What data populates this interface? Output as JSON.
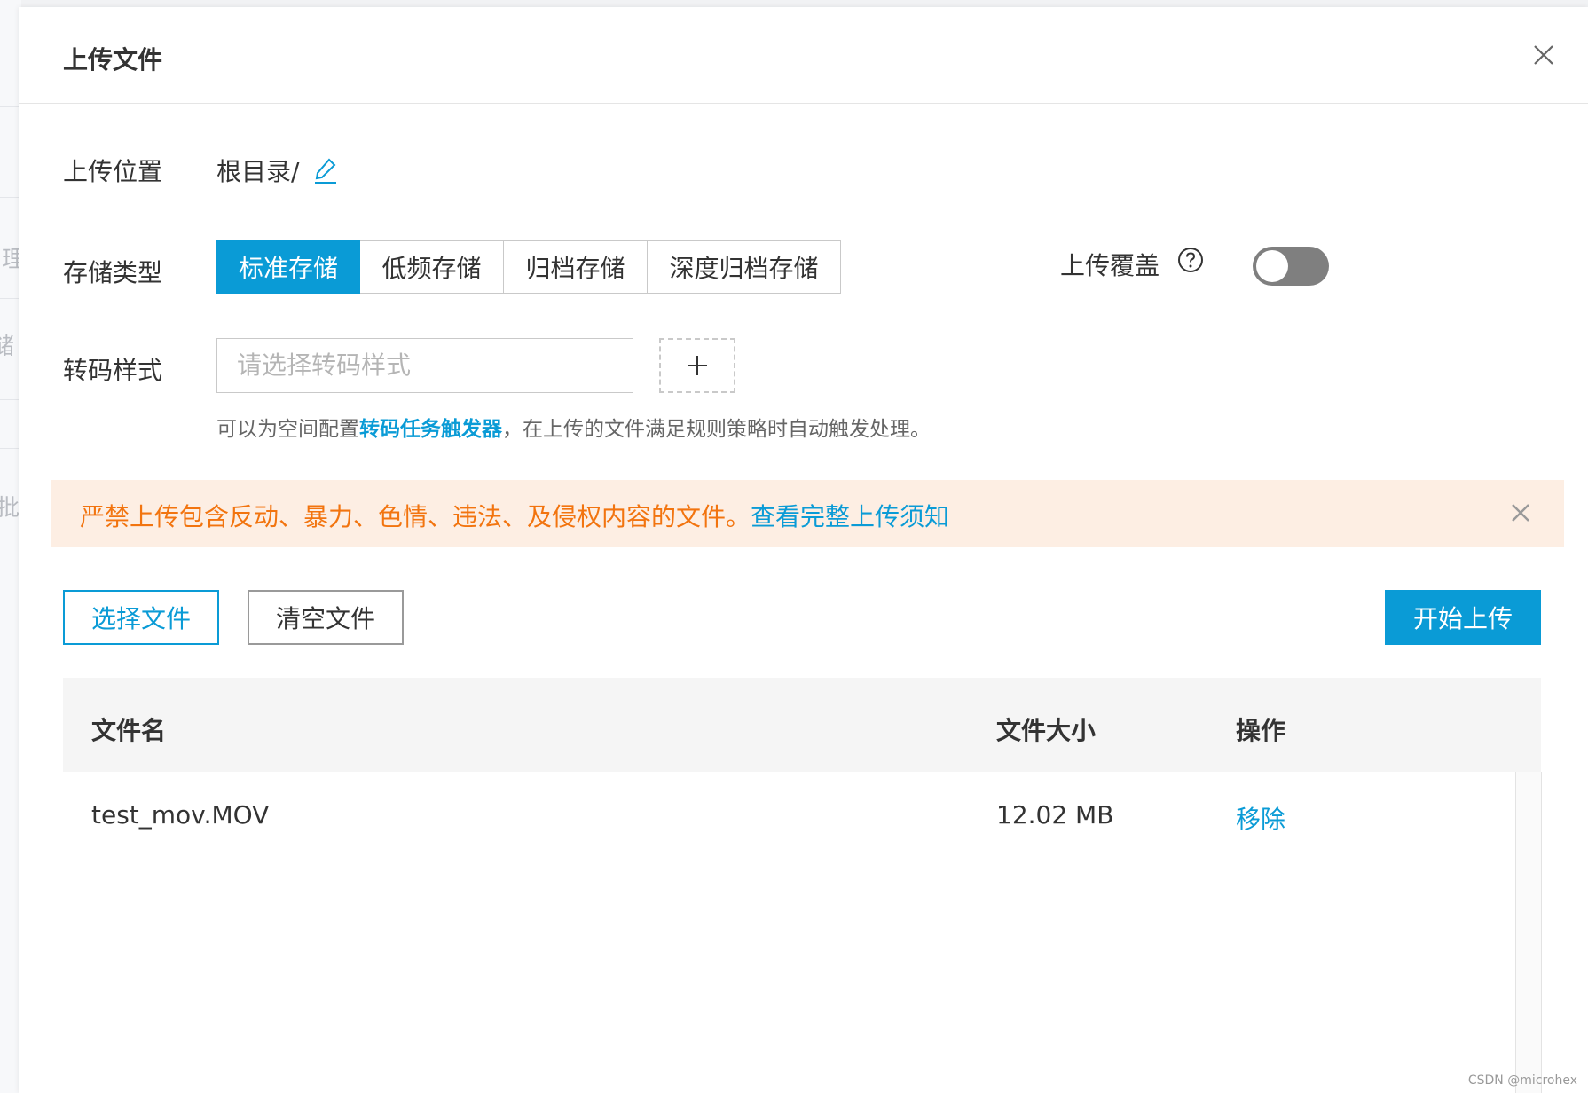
{
  "dialog": {
    "title": "上传文件",
    "close_icon": "close-icon"
  },
  "location": {
    "label": "上传位置",
    "value": "根目录/",
    "edit_icon": "pencil-icon"
  },
  "storage": {
    "label": "存储类型",
    "options": [
      {
        "label": "标准存储",
        "active": true
      },
      {
        "label": "低频存储",
        "active": false
      },
      {
        "label": "归档存储",
        "active": false
      },
      {
        "label": "深度归档存储",
        "active": false
      }
    ],
    "overwrite_label": "上传覆盖",
    "help_icon": "question-circle-icon",
    "overwrite_enabled": false
  },
  "transcode": {
    "label": "转码样式",
    "placeholder": "请选择转码样式",
    "add_icon": "plus-icon",
    "hint_prefix": "可以为空间配置",
    "hint_link": "转码任务触发器",
    "hint_suffix": "，在上传的文件满足规则策略时自动触发处理。"
  },
  "notice": {
    "text": "严禁上传包含反动、暴力、色情、违法、及侵权内容的文件。",
    "link": "查看完整上传须知",
    "close_icon": "close-icon"
  },
  "actions": {
    "select_files": "选择文件",
    "clear_files": "清空文件",
    "start_upload": "开始上传"
  },
  "table": {
    "headers": {
      "name": "文件名",
      "size": "文件大小",
      "action": "操作"
    },
    "rows": [
      {
        "name": "test_mov.MOV",
        "size": "12.02 MB",
        "action": "移除"
      }
    ]
  },
  "colors": {
    "accent": "#0a9bd6",
    "warning_text": "#f2740f",
    "warning_bg": "#fdeee3",
    "toggle_off": "#7f7f7f"
  },
  "watermark": "CSDN @microhex",
  "background": {
    "glyphs": [
      ":",
      "理",
      "储",
      "批"
    ]
  }
}
